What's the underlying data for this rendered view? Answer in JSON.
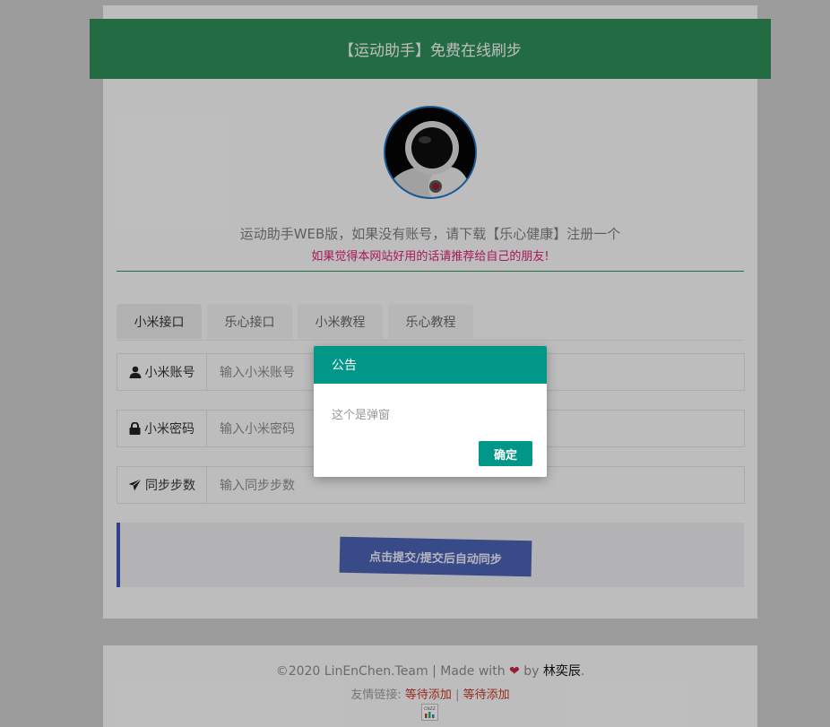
{
  "header": {
    "title": "【运动助手】免费在线刷步"
  },
  "intro": {
    "description": "运动助手WEB版，如果没有账号，请下载【乐心健康】注册一个",
    "notice": "如果觉得本网站好用的话请推荐给自己的朋友!"
  },
  "tabs": [
    {
      "label": "小米接口"
    },
    {
      "label": "乐心接口"
    },
    {
      "label": "小米教程"
    },
    {
      "label": "乐心教程"
    }
  ],
  "form": {
    "account": {
      "label": "小米账号",
      "placeholder": "输入小米账号",
      "icon": "user-icon"
    },
    "password": {
      "label": "小米密码",
      "placeholder": "输入小米密码",
      "icon": "lock-icon"
    },
    "steps": {
      "label": "同步步数",
      "placeholder": "输入同步步数",
      "icon": "send-icon"
    },
    "submit_label": "点击提交/提交后自动同步"
  },
  "footer": {
    "copyright": "©2020 LinEnChen.Team | Made with",
    "by": "by",
    "author": "林奕辰",
    "period": ".",
    "links_label": "友情链接:",
    "link1": "等待添加",
    "separator": "|",
    "link2": "等待添加",
    "badge_label": "CNZZ"
  },
  "dialog": {
    "title": "公告",
    "message": "这个是弹窗",
    "confirm_label": "确定"
  },
  "colors": {
    "header": "#2e8b57",
    "notice": "#d91f6e",
    "submit": "#4a5fb0",
    "dialog_accent": "#009688"
  }
}
